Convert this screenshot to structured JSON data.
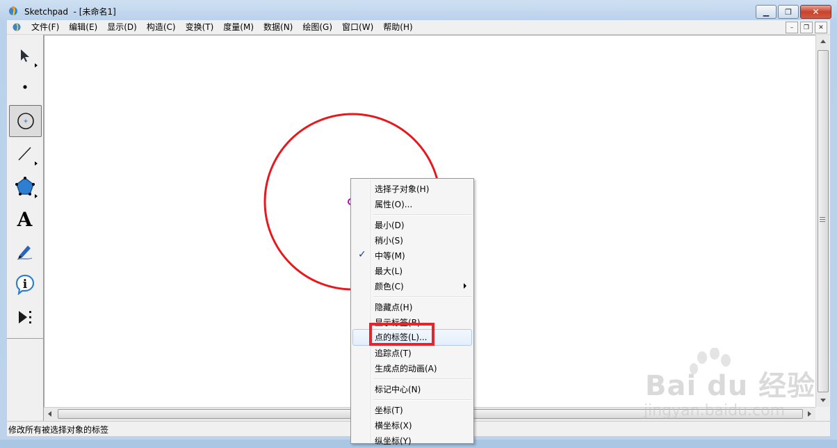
{
  "window": {
    "title": "Sketchpad  - [未命名1]",
    "icons": {
      "app": "sketchpad-logo-icon",
      "minimize": "minimize-icon",
      "maximize": "maximize-icon",
      "close": "close-icon"
    }
  },
  "menubar": {
    "items": [
      {
        "label": "文件(F)"
      },
      {
        "label": "编辑(E)"
      },
      {
        "label": "显示(D)"
      },
      {
        "label": "构造(C)"
      },
      {
        "label": "变换(T)"
      },
      {
        "label": "度量(M)"
      },
      {
        "label": "数据(N)"
      },
      {
        "label": "绘图(G)"
      },
      {
        "label": "窗口(W)"
      },
      {
        "label": "帮助(H)"
      }
    ]
  },
  "toolbox": {
    "tools": [
      {
        "name": "arrow-selection-tool",
        "icon": "arrow-icon"
      },
      {
        "name": "point-tool",
        "icon": "point-icon"
      },
      {
        "name": "compass-tool",
        "icon": "compass-icon",
        "active": true
      },
      {
        "name": "straightedge-tool",
        "icon": "line-icon"
      },
      {
        "name": "polygon-tool",
        "icon": "pentagon-icon"
      },
      {
        "name": "text-tool",
        "icon": "text-a-icon",
        "glyph": "A"
      },
      {
        "name": "marker-tool",
        "icon": "marker-icon"
      },
      {
        "name": "information-tool",
        "icon": "info-icon",
        "glyph": "i"
      },
      {
        "name": "custom-tool",
        "icon": "custom-tool-icon"
      }
    ]
  },
  "canvas": {
    "circle_color": "#e8171c",
    "center_point_color": "#c000c0"
  },
  "context_menu": {
    "items": [
      {
        "label": "选择子对象(H)"
      },
      {
        "label": "属性(O)..."
      },
      {
        "label": "最小(D)"
      },
      {
        "label": "稍小(S)"
      },
      {
        "label": "中等(M)",
        "checked": true
      },
      {
        "label": "最大(L)"
      },
      {
        "label": "颜色(C)",
        "submenu": true
      },
      {
        "label": "隐藏点(H)"
      },
      {
        "label": "显示标签(B)"
      },
      {
        "label": "点的标签(L)...",
        "highlighted": true
      },
      {
        "label": "追踪点(T)"
      },
      {
        "label": "生成点的动画(A)"
      },
      {
        "label": "标记中心(N)"
      },
      {
        "label": "坐标(T)"
      },
      {
        "label": "横坐标(X)"
      },
      {
        "label": "纵坐标(Y)"
      }
    ],
    "check_mark": "✓"
  },
  "statusbar": {
    "text": "修改所有被选择对象的标签"
  },
  "watermark": {
    "brand": "Bai du 经验",
    "url": "jingyan.baidu.com"
  },
  "colors": {
    "highlight_box": "#e8242b",
    "accent": "#1a3f7a"
  }
}
